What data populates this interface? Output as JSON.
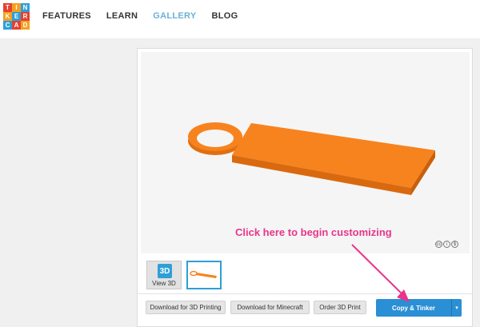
{
  "logo": {
    "letters": [
      "T",
      "I",
      "N",
      "K",
      "E",
      "R",
      "C",
      "A",
      "D"
    ],
    "colors": [
      "#e5412f",
      "#f6a020",
      "#2f9fd7",
      "#f6a020",
      "#2f9fd7",
      "#e5412f",
      "#2f9fd7",
      "#e5412f",
      "#f6a020"
    ]
  },
  "nav": {
    "features": "FEATURES",
    "learn": "LEARN",
    "gallery": "GALLERY",
    "blog": "BLOG"
  },
  "viewer": {
    "hint": "Click here to begin customizing",
    "icon_a": "cc",
    "icon_b": "i",
    "icon_c": "$"
  },
  "thumbs": {
    "view3d_label": "View 3D",
    "view3d_glyph": "3D"
  },
  "actions": {
    "download_3d": "Download for 3D Printing",
    "download_minecraft": "Download for Minecraft",
    "order_print": "Order 3D Print",
    "copy_tinker": "Copy & Tinker",
    "caret": "▾"
  },
  "colors": {
    "model": "#f7831f",
    "accent": "#2a8fd4",
    "hint": "#e8358a"
  }
}
